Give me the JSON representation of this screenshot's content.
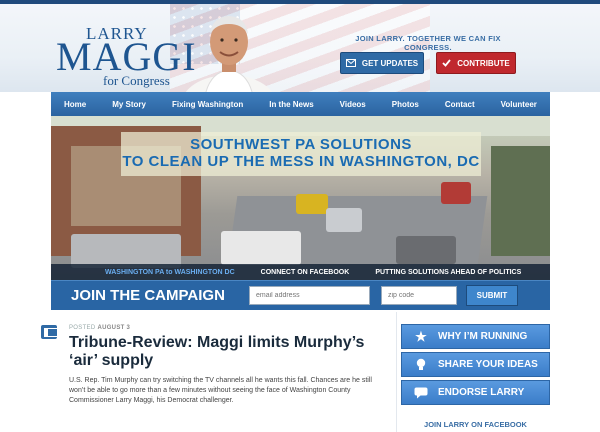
{
  "header": {
    "logo": {
      "larry": "LARRY",
      "maggi": "MAGGI",
      "for_congress": "for Congress"
    },
    "tagline": "JOIN LARRY. TOGETHER WE CAN FIX CONGRESS.",
    "get_updates_label": "GET UPDATES",
    "contribute_label": "CONTRIBUTE"
  },
  "nav": {
    "items": [
      "Home",
      "My Story",
      "Fixing Washington",
      "In the News",
      "Videos",
      "Photos",
      "Contact",
      "Volunteer"
    ]
  },
  "hero": {
    "line1": "SOUTHWEST PA SOLUTIONS",
    "line2": "TO CLEAN UP THE MESS IN WASHINGTON, DC",
    "tabs": [
      "WASHINGTON PA to WASHINGTON DC",
      "CONNECT ON FACEBOOK",
      "PUTTING SOLUTIONS AHEAD OF POLITICS"
    ]
  },
  "campaign": {
    "title": "JOIN THE CAMPAIGN",
    "email_placeholder": "email address",
    "zip_placeholder": "zip code",
    "submit_label": "SUBMIT"
  },
  "post": {
    "posted_prefix": "POSTED",
    "posted_date": "AUGUST 3",
    "headline": "Tribune-Review: Maggi limits Murphy’s ‘air’ supply",
    "body": "U.S. Rep. Tim Murphy can try switching the TV channels all he wants this fall. Chances are he still won’t be able to go more than a few minutes without seeing the face of Washington County Commissioner Larry Maggi, his Democrat challenger."
  },
  "sidebar": {
    "buttons": [
      {
        "label": "WHY I’M RUNNING",
        "icon": "star-icon"
      },
      {
        "label": "SHARE YOUR IDEAS",
        "icon": "lightbulb-icon"
      },
      {
        "label": "ENDORSE LARRY",
        "icon": "speech-bubble-icon"
      }
    ],
    "facebook_link": "JOIN LARRY ON FACEBOOK"
  },
  "colors": {
    "brand_blue": "#2965a4",
    "accent_red": "#c0282e",
    "banner_text": "#1a6bb2"
  }
}
